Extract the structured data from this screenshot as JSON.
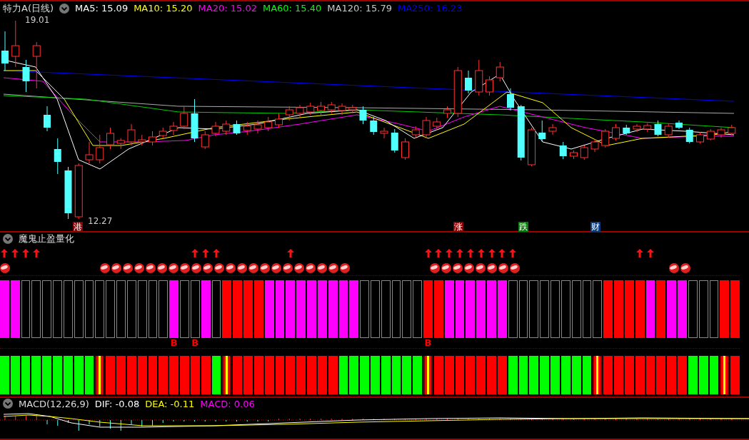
{
  "chart_header": {
    "title": "特力A(日线)",
    "moving_averages": [
      {
        "label": "MA5: 15.09",
        "color": "#ffffff"
      },
      {
        "label": "MA10: 15.20",
        "color": "#ffff00"
      },
      {
        "label": "MA20: 15.02",
        "color": "#ff00ff"
      },
      {
        "label": "MA60: 15.40",
        "color": "#00ff00"
      },
      {
        "label": "MA120: 15.79",
        "color": "#c8c8c8"
      },
      {
        "label": "MA250: 16.23",
        "color": "#0000ff"
      }
    ]
  },
  "price_labels": [
    "19.01",
    "12.27"
  ],
  "event_tags": [
    {
      "text": "港",
      "color": "#8b0000"
    },
    {
      "text": "涨",
      "color": "#8b0000"
    },
    {
      "text": "跌",
      "color": "#0a7a0a"
    },
    {
      "text": "财",
      "color": "#0a3a7a"
    }
  ],
  "indicator": {
    "title": "魔鬼止盈量化",
    "bars": [
      {
        "upper": {
          "kind": "solid",
          "color": "#ff00ff"
        },
        "lower": {
          "kind": "solid",
          "color": "#00ff00"
        },
        "arrow": true,
        "ball": true
      },
      {
        "upper": {
          "kind": "solid",
          "color": "#ff00ff"
        },
        "lower": {
          "kind": "solid",
          "color": "#00ff00"
        },
        "arrow": true,
        "ball": false
      },
      {
        "upper": {
          "kind": "hollow"
        },
        "lower": {
          "kind": "solid",
          "color": "#00ff00"
        },
        "arrow": true,
        "ball": false
      },
      {
        "upper": {
          "kind": "hollow"
        },
        "lower": {
          "kind": "solid",
          "color": "#00ff00"
        },
        "arrow": true,
        "ball": false
      },
      {
        "upper": {
          "kind": "hollow"
        },
        "lower": {
          "kind": "solid",
          "color": "#00ff00"
        },
        "arrow": false,
        "ball": false
      },
      {
        "upper": {
          "kind": "hollow"
        },
        "lower": {
          "kind": "solid",
          "color": "#00ff00"
        },
        "arrow": false,
        "ball": false
      },
      {
        "upper": {
          "kind": "hollow"
        },
        "lower": {
          "kind": "solid",
          "color": "#00ff00"
        },
        "arrow": false,
        "ball": false
      },
      {
        "upper": {
          "kind": "hollow"
        },
        "lower": {
          "kind": "solid",
          "color": "#00ff00"
        },
        "arrow": false,
        "ball": false
      },
      {
        "upper": {
          "kind": "hollow"
        },
        "lower": {
          "kind": "solid",
          "color": "#00ff00"
        },
        "arrow": false,
        "ball": false
      },
      {
        "upper": {
          "kind": "hollow"
        },
        "lower": {
          "kind": "flag"
        },
        "arrow": false,
        "ball": false
      },
      {
        "upper": {
          "kind": "hollow"
        },
        "lower": {
          "kind": "solid",
          "color": "#ff0000"
        },
        "arrow": false,
        "ball": true
      },
      {
        "upper": {
          "kind": "hollow"
        },
        "lower": {
          "kind": "solid",
          "color": "#ff0000"
        },
        "arrow": false,
        "ball": true
      },
      {
        "upper": {
          "kind": "hollow"
        },
        "lower": {
          "kind": "solid",
          "color": "#ff0000"
        },
        "arrow": false,
        "ball": true
      },
      {
        "upper": {
          "kind": "hollow"
        },
        "lower": {
          "kind": "solid",
          "color": "#ff0000"
        },
        "arrow": false,
        "ball": true
      },
      {
        "upper": {
          "kind": "hollow"
        },
        "lower": {
          "kind": "solid",
          "color": "#ff0000"
        },
        "arrow": false,
        "ball": true
      },
      {
        "upper": {
          "kind": "hollow"
        },
        "lower": {
          "kind": "solid",
          "color": "#ff0000"
        },
        "arrow": false,
        "ball": true
      },
      {
        "upper": {
          "kind": "solid",
          "color": "#ff00ff"
        },
        "lower": {
          "kind": "solid",
          "color": "#ff0000"
        },
        "arrow": false,
        "ball": true,
        "signal": "B"
      },
      {
        "upper": {
          "kind": "hollow"
        },
        "lower": {
          "kind": "solid",
          "color": "#ff0000"
        },
        "arrow": false,
        "ball": true
      },
      {
        "upper": {
          "kind": "hollow"
        },
        "lower": {
          "kind": "solid",
          "color": "#ff0000"
        },
        "arrow": true,
        "ball": true,
        "signal": "B"
      },
      {
        "upper": {
          "kind": "solid",
          "color": "#ff00ff"
        },
        "lower": {
          "kind": "solid",
          "color": "#ff0000"
        },
        "arrow": true,
        "ball": true
      },
      {
        "upper": {
          "kind": "hollow"
        },
        "lower": {
          "kind": "solid",
          "color": "#00ff00"
        },
        "arrow": true,
        "ball": true
      },
      {
        "upper": {
          "kind": "solid",
          "color": "#ff0000"
        },
        "lower": {
          "kind": "flag"
        },
        "arrow": false,
        "ball": true
      },
      {
        "upper": {
          "kind": "solid",
          "color": "#ff0000"
        },
        "lower": {
          "kind": "solid",
          "color": "#ff0000"
        },
        "arrow": false,
        "ball": true
      },
      {
        "upper": {
          "kind": "solid",
          "color": "#ff0000"
        },
        "lower": {
          "kind": "solid",
          "color": "#ff0000"
        },
        "arrow": false,
        "ball": true
      },
      {
        "upper": {
          "kind": "solid",
          "color": "#ff0000"
        },
        "lower": {
          "kind": "solid",
          "color": "#ff0000"
        },
        "arrow": false,
        "ball": true
      },
      {
        "upper": {
          "kind": "solid",
          "color": "#ff00ff"
        },
        "lower": {
          "kind": "solid",
          "color": "#ff0000"
        },
        "arrow": false,
        "ball": true
      },
      {
        "upper": {
          "kind": "solid",
          "color": "#ff00ff"
        },
        "lower": {
          "kind": "solid",
          "color": "#ff0000"
        },
        "arrow": false,
        "ball": true
      },
      {
        "upper": {
          "kind": "solid",
          "color": "#ff00ff"
        },
        "lower": {
          "kind": "solid",
          "color": "#ff0000"
        },
        "arrow": true,
        "ball": true
      },
      {
        "upper": {
          "kind": "solid",
          "color": "#ff00ff"
        },
        "lower": {
          "kind": "solid",
          "color": "#ff0000"
        },
        "arrow": false,
        "ball": true
      },
      {
        "upper": {
          "kind": "solid",
          "color": "#ff00ff"
        },
        "lower": {
          "kind": "solid",
          "color": "#ff0000"
        },
        "arrow": false,
        "ball": true
      },
      {
        "upper": {
          "kind": "solid",
          "color": "#ff00ff"
        },
        "lower": {
          "kind": "solid",
          "color": "#ff0000"
        },
        "arrow": false,
        "ball": true
      },
      {
        "upper": {
          "kind": "solid",
          "color": "#ff00ff"
        },
        "lower": {
          "kind": "solid",
          "color": "#ff0000"
        },
        "arrow": false,
        "ball": true
      },
      {
        "upper": {
          "kind": "solid",
          "color": "#ff00ff"
        },
        "lower": {
          "kind": "solid",
          "color": "#00ff00"
        },
        "arrow": false,
        "ball": false
      },
      {
        "upper": {
          "kind": "solid",
          "color": "#ff00ff"
        },
        "lower": {
          "kind": "solid",
          "color": "#00ff00"
        },
        "arrow": false,
        "ball": false
      },
      {
        "upper": {
          "kind": "hollow"
        },
        "lower": {
          "kind": "solid",
          "color": "#00ff00"
        },
        "arrow": false,
        "ball": false
      },
      {
        "upper": {
          "kind": "hollow"
        },
        "lower": {
          "kind": "solid",
          "color": "#00ff00"
        },
        "arrow": false,
        "ball": false
      },
      {
        "upper": {
          "kind": "hollow"
        },
        "lower": {
          "kind": "solid",
          "color": "#00ff00"
        },
        "arrow": false,
        "ball": false
      },
      {
        "upper": {
          "kind": "hollow"
        },
        "lower": {
          "kind": "solid",
          "color": "#00ff00"
        },
        "arrow": false,
        "ball": false
      },
      {
        "upper": {
          "kind": "hollow"
        },
        "lower": {
          "kind": "solid",
          "color": "#00ff00"
        },
        "arrow": false,
        "ball": false
      },
      {
        "upper": {
          "kind": "hollow"
        },
        "lower": {
          "kind": "solid",
          "color": "#00ff00"
        },
        "arrow": false,
        "ball": false
      },
      {
        "upper": {
          "kind": "solid",
          "color": "#ff0000"
        },
        "lower": {
          "kind": "flag"
        },
        "arrow": true,
        "ball": true,
        "signal": "B"
      },
      {
        "upper": {
          "kind": "solid",
          "color": "#ff0000"
        },
        "lower": {
          "kind": "solid",
          "color": "#ff0000"
        },
        "arrow": true,
        "ball": true
      },
      {
        "upper": {
          "kind": "solid",
          "color": "#ff00ff"
        },
        "lower": {
          "kind": "solid",
          "color": "#ff0000"
        },
        "arrow": true,
        "ball": true
      },
      {
        "upper": {
          "kind": "solid",
          "color": "#ff00ff"
        },
        "lower": {
          "kind": "solid",
          "color": "#ff0000"
        },
        "arrow": true,
        "ball": true
      },
      {
        "upper": {
          "kind": "solid",
          "color": "#ff00ff"
        },
        "lower": {
          "kind": "solid",
          "color": "#ff0000"
        },
        "arrow": true,
        "ball": true
      },
      {
        "upper": {
          "kind": "solid",
          "color": "#ff00ff"
        },
        "lower": {
          "kind": "solid",
          "color": "#ff0000"
        },
        "arrow": true,
        "ball": true
      },
      {
        "upper": {
          "kind": "solid",
          "color": "#ff00ff"
        },
        "lower": {
          "kind": "solid",
          "color": "#ff0000"
        },
        "arrow": true,
        "ball": true
      },
      {
        "upper": {
          "kind": "solid",
          "color": "#ff00ff"
        },
        "lower": {
          "kind": "solid",
          "color": "#ff0000"
        },
        "arrow": true,
        "ball": true
      },
      {
        "upper": {
          "kind": "hollow"
        },
        "lower": {
          "kind": "solid",
          "color": "#00ff00"
        },
        "arrow": true,
        "ball": false
      },
      {
        "upper": {
          "kind": "hollow"
        },
        "lower": {
          "kind": "solid",
          "color": "#00ff00"
        },
        "arrow": false,
        "ball": false
      },
      {
        "upper": {
          "kind": "hollow"
        },
        "lower": {
          "kind": "solid",
          "color": "#00ff00"
        },
        "arrow": false,
        "ball": false
      },
      {
        "upper": {
          "kind": "hollow"
        },
        "lower": {
          "kind": "solid",
          "color": "#00ff00"
        },
        "arrow": false,
        "ball": false
      },
      {
        "upper": {
          "kind": "hollow"
        },
        "lower": {
          "kind": "solid",
          "color": "#00ff00"
        },
        "arrow": false,
        "ball": false
      },
      {
        "upper": {
          "kind": "hollow"
        },
        "lower": {
          "kind": "solid",
          "color": "#00ff00"
        },
        "arrow": false,
        "ball": false
      },
      {
        "upper": {
          "kind": "hollow"
        },
        "lower": {
          "kind": "solid",
          "color": "#00ff00"
        },
        "arrow": false,
        "ball": false
      },
      {
        "upper": {
          "kind": "hollow"
        },
        "lower": {
          "kind": "solid",
          "color": "#00ff00"
        },
        "arrow": false,
        "ball": false
      },
      {
        "upper": {
          "kind": "hollow"
        },
        "lower": {
          "kind": "flag"
        },
        "arrow": false,
        "ball": false
      },
      {
        "upper": {
          "kind": "solid",
          "color": "#ff0000"
        },
        "lower": {
          "kind": "solid",
          "color": "#ff0000"
        },
        "arrow": false,
        "ball": false
      },
      {
        "upper": {
          "kind": "solid",
          "color": "#ff0000"
        },
        "lower": {
          "kind": "solid",
          "color": "#ff0000"
        },
        "arrow": false,
        "ball": false
      },
      {
        "upper": {
          "kind": "solid",
          "color": "#ff0000"
        },
        "lower": {
          "kind": "solid",
          "color": "#ff0000"
        },
        "arrow": false,
        "ball": false
      },
      {
        "upper": {
          "kind": "solid",
          "color": "#ff0000"
        },
        "lower": {
          "kind": "solid",
          "color": "#ff0000"
        },
        "arrow": true,
        "ball": false
      },
      {
        "upper": {
          "kind": "solid",
          "color": "#ff00ff"
        },
        "lower": {
          "kind": "solid",
          "color": "#ff0000"
        },
        "arrow": true,
        "ball": false
      },
      {
        "upper": {
          "kind": "solid",
          "color": "#ff0000"
        },
        "lower": {
          "kind": "solid",
          "color": "#ff0000"
        },
        "arrow": false,
        "ball": false
      },
      {
        "upper": {
          "kind": "solid",
          "color": "#ff00ff"
        },
        "lower": {
          "kind": "solid",
          "color": "#ff0000"
        },
        "arrow": false,
        "ball": true
      },
      {
        "upper": {
          "kind": "solid",
          "color": "#ff00ff"
        },
        "lower": {
          "kind": "solid",
          "color": "#ff0000"
        },
        "arrow": false,
        "ball": true
      },
      {
        "upper": {
          "kind": "hollow"
        },
        "lower": {
          "kind": "solid",
          "color": "#00ff00"
        },
        "arrow": false,
        "ball": false
      },
      {
        "upper": {
          "kind": "hollow"
        },
        "lower": {
          "kind": "solid",
          "color": "#00ff00"
        },
        "arrow": false,
        "ball": false
      },
      {
        "upper": {
          "kind": "hollow"
        },
        "lower": {
          "kind": "solid",
          "color": "#00ff00"
        },
        "arrow": false,
        "ball": false
      },
      {
        "upper": {
          "kind": "solid",
          "color": "#ff0000"
        },
        "lower": {
          "kind": "flag"
        },
        "arrow": false,
        "ball": false
      },
      {
        "upper": {
          "kind": "solid",
          "color": "#ff0000"
        },
        "lower": {
          "kind": "solid",
          "color": "#ff0000"
        },
        "arrow": false,
        "ball": false
      }
    ]
  },
  "macd_header": {
    "title": "MACD(12,26,9)",
    "values": [
      {
        "label": "DIF: -0.08",
        "color": "#ffffff"
      },
      {
        "label": "DEA: -0.11",
        "color": "#ffff00"
      },
      {
        "label": "MACD: 0.06",
        "color": "#ff00ff"
      }
    ]
  }
}
